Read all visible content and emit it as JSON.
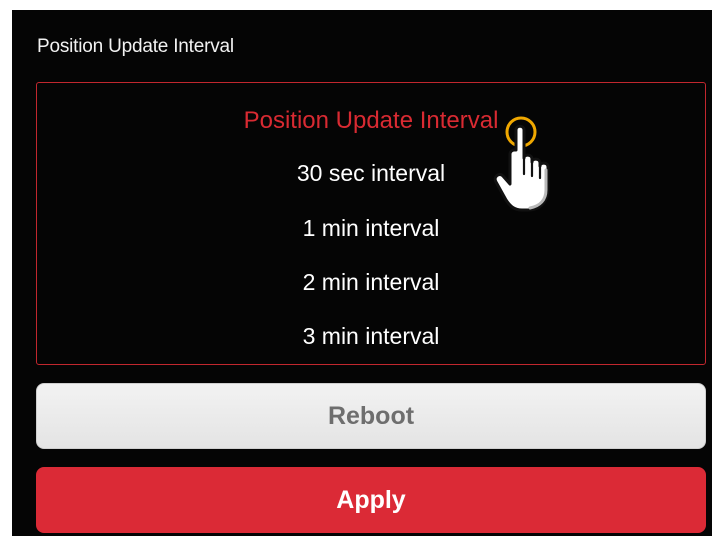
{
  "header": {
    "title": "Position Update Interval"
  },
  "picker": {
    "title": "Position Update Interval",
    "options": [
      "30 sec interval",
      "1 min interval",
      "2 min interval",
      "3 min interval"
    ]
  },
  "buttons": {
    "reboot_label": "Reboot",
    "apply_label": "Apply"
  },
  "colors": {
    "background": "#050505",
    "accent_red": "#db2a36",
    "picker_border": "#c2272e",
    "reboot_bg": "#eeeeee",
    "pointer_ring": "#f0a800"
  },
  "icons": {
    "pointer": "hand-pointer-icon"
  }
}
